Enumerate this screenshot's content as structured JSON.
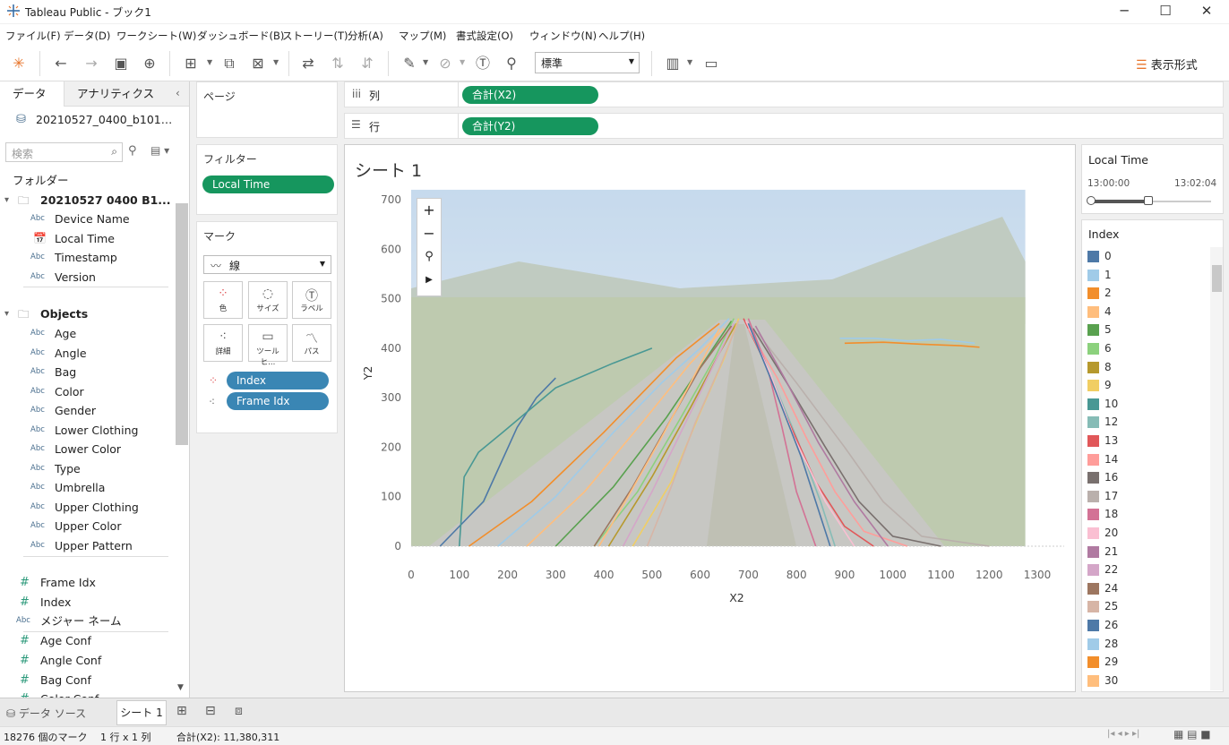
{
  "window": {
    "title": "Tableau Public - ブック1",
    "min": "─",
    "max": "☐",
    "close": "✕"
  },
  "menu": [
    "ファイル(F)",
    "データ(D)",
    "ワークシート(W)",
    "ダッシュボード(B)",
    "ストーリー(T)",
    "分析(A)",
    "マップ(M)",
    "書式設定(O)",
    "ウィンドウ(N)",
    "ヘルプ(H)"
  ],
  "toolbar": {
    "fit_select": "標準",
    "show_me": "表示形式"
  },
  "datapane": {
    "tab_data": "データ",
    "tab_analytics": "アナリティクス",
    "datasource": "20210527_0400_b101…",
    "search_placeholder": "検索",
    "folders_label": "フォルダー",
    "folder1": "20210527 0400 B1...",
    "folder1_fields": [
      {
        "type": "Abc",
        "name": "Device Name"
      },
      {
        "type": "date",
        "name": "Local Time"
      },
      {
        "type": "Abc",
        "name": "Timestamp"
      },
      {
        "type": "Abc",
        "name": "Version"
      }
    ],
    "folder2": "Objects",
    "folder2_fields": [
      "Age",
      "Angle",
      "Bag",
      "Color",
      "Gender",
      "Lower Clothing",
      "Lower Color",
      "Type",
      "Umbrella",
      "Upper Clothing",
      "Upper Color",
      "Upper Pattern"
    ],
    "type_abc": "Abc",
    "measures": [
      {
        "type": "#",
        "name": "Frame Idx"
      },
      {
        "type": "#",
        "name": "Index"
      },
      {
        "type": "Abc",
        "name": "メジャー ネーム"
      },
      {
        "type": "#",
        "name": "Age Conf"
      },
      {
        "type": "#",
        "name": "Angle Conf"
      },
      {
        "type": "#",
        "name": "Bag Conf"
      },
      {
        "type": "#",
        "name": "Color Conf"
      }
    ]
  },
  "shelves": {
    "pages": "ページ",
    "columns_label": "列",
    "columns_pill": "合計(X2)",
    "rows_label": "行",
    "rows_pill": "合計(Y2)",
    "filters": "フィルター",
    "filter_pill": "Local Time",
    "marks": "マーク",
    "mark_type": "線",
    "mark_buttons": [
      "色",
      "サイズ",
      "ラベル",
      "詳細",
      "ツールヒ...",
      "パス"
    ],
    "mark_pills": [
      "Index",
      "Frame Idx"
    ]
  },
  "sheet": {
    "title": "シート 1",
    "map_controls": [
      "+",
      "−",
      "⚲",
      "▶"
    ]
  },
  "chart_data": {
    "type": "line",
    "xlabel": "X2",
    "ylabel": "Y2",
    "xlim": [
      0,
      1300
    ],
    "ylim": [
      0,
      700
    ],
    "x_ticks": [
      0,
      100,
      200,
      300,
      400,
      500,
      600,
      700,
      800,
      900,
      1000,
      1100,
      1200,
      1300
    ],
    "y_ticks": [
      0,
      100,
      200,
      300,
      400,
      500,
      600,
      700
    ],
    "color_by": "Index",
    "background_image_extent": {
      "x": [
        0,
        1275
      ],
      "y": [
        0,
        720
      ]
    },
    "series": [
      {
        "index": 0,
        "x": [
          60,
          150,
          220,
          260,
          300
        ],
        "y": [
          0,
          90,
          240,
          300,
          340
        ]
      },
      {
        "index": 1,
        "x": [
          180,
          300,
          420,
          520,
          600,
          660
        ],
        "y": [
          0,
          100,
          230,
          330,
          400,
          460
        ]
      },
      {
        "index": 2,
        "x": [
          120,
          250,
          400,
          550,
          640
        ],
        "y": [
          0,
          90,
          230,
          380,
          450
        ]
      },
      {
        "index": 4,
        "x": [
          240,
          360,
          480,
          580,
          650
        ],
        "y": [
          0,
          110,
          250,
          370,
          440
        ]
      },
      {
        "index": 5,
        "x": [
          300,
          420,
          530,
          620,
          665
        ],
        "y": [
          0,
          120,
          260,
          390,
          455
        ]
      },
      {
        "index": 6,
        "x": [
          380,
          470,
          560,
          630,
          670
        ],
        "y": [
          0,
          110,
          260,
          380,
          460
        ]
      },
      {
        "index": 8,
        "x": [
          410,
          500,
          580,
          640,
          675
        ],
        "y": [
          0,
          140,
          280,
          390,
          450
        ]
      },
      {
        "index": 9,
        "x": [
          460,
          540,
          600,
          650,
          680
        ],
        "y": [
          0,
          130,
          270,
          380,
          460
        ]
      },
      {
        "index": 10,
        "x": [
          100,
          110,
          140,
          190,
          300,
          420,
          500
        ],
        "y": [
          0,
          140,
          190,
          230,
          320,
          370,
          400
        ]
      },
      {
        "index": 12,
        "x": [
          700,
          740,
          800,
          850,
          880
        ],
        "y": [
          450,
          360,
          220,
          90,
          0
        ]
      },
      {
        "index": 13,
        "x": [
          690,
          730,
          780,
          840,
          900,
          960
        ],
        "y": [
          460,
          380,
          260,
          130,
          40,
          0
        ]
      },
      {
        "index": 14,
        "x": [
          700,
          760,
          820,
          880,
          940,
          1030
        ],
        "y": [
          440,
          340,
          220,
          110,
          30,
          0
        ]
      },
      {
        "index": 16,
        "x": [
          710,
          780,
          860,
          930,
          1000,
          1100
        ],
        "y": [
          440,
          330,
          200,
          90,
          20,
          0
        ]
      },
      {
        "index": 17,
        "x": [
          720,
          800,
          900,
          980,
          1060,
          1200
        ],
        "y": [
          430,
          330,
          200,
          90,
          20,
          0
        ]
      },
      {
        "index": 18,
        "x": [
          700,
          740,
          770,
          800,
          840
        ],
        "y": [
          460,
          360,
          240,
          110,
          0
        ]
      },
      {
        "index": 20,
        "x": [
          695,
          745,
          795,
          860,
          920
        ],
        "y": [
          455,
          350,
          220,
          90,
          0
        ]
      },
      {
        "index": 21,
        "x": [
          715,
          775,
          845,
          920,
          990
        ],
        "y": [
          445,
          340,
          210,
          90,
          0
        ]
      },
      {
        "index": 22,
        "x": [
          670,
          620,
          560,
          500,
          440
        ],
        "y": [
          450,
          350,
          230,
          110,
          0
        ]
      },
      {
        "index": 24,
        "x": [
          665,
          600,
          530,
          460,
          380
        ],
        "y": [
          445,
          360,
          240,
          120,
          0
        ]
      },
      {
        "index": 25,
        "x": [
          680,
          640,
          590,
          540,
          490
        ],
        "y": [
          455,
          360,
          250,
          120,
          0
        ]
      },
      {
        "index": 26,
        "x": [
          700,
          750,
          810,
          870
        ],
        "y": [
          450,
          330,
          180,
          0
        ]
      },
      {
        "index": 28,
        "x": [
          890,
          960,
          1030,
          1100,
          1170
        ],
        "y": [
          420,
          420,
          415,
          418,
          410
        ]
      },
      {
        "index": 29,
        "x": [
          900,
          980,
          1060,
          1140,
          1180
        ],
        "y": [
          410,
          412,
          408,
          405,
          402
        ]
      },
      {
        "index": 30,
        "x": [
          640,
          580,
          520,
          450,
          390
        ],
        "y": [
          440,
          330,
          220,
          100,
          0
        ]
      }
    ]
  },
  "legend_filter": {
    "title": "Local Time",
    "start": "13:00:00",
    "end": "13:02:04",
    "range_fraction": [
      0.0,
      0.48
    ]
  },
  "legend_color": {
    "title": "Index",
    "items": [
      {
        "label": "0",
        "color": "#4e79a7"
      },
      {
        "label": "1",
        "color": "#a0cbe8"
      },
      {
        "label": "2",
        "color": "#f28e2b"
      },
      {
        "label": "4",
        "color": "#ffbe7d"
      },
      {
        "label": "5",
        "color": "#59a14f"
      },
      {
        "label": "6",
        "color": "#8cd17d"
      },
      {
        "label": "8",
        "color": "#b6992d"
      },
      {
        "label": "9",
        "color": "#f1ce63"
      },
      {
        "label": "10",
        "color": "#499894"
      },
      {
        "label": "12",
        "color": "#86bcb6"
      },
      {
        "label": "13",
        "color": "#e15759"
      },
      {
        "label": "14",
        "color": "#ff9d9a"
      },
      {
        "label": "16",
        "color": "#79706e"
      },
      {
        "label": "17",
        "color": "#bab0ac"
      },
      {
        "label": "18",
        "color": "#d37295"
      },
      {
        "label": "20",
        "color": "#fabfd2"
      },
      {
        "label": "21",
        "color": "#b07aa1"
      },
      {
        "label": "22",
        "color": "#d4a6c8"
      },
      {
        "label": "24",
        "color": "#9d7660"
      },
      {
        "label": "25",
        "color": "#d7b5a6"
      },
      {
        "label": "26",
        "color": "#4e79a7"
      },
      {
        "label": "28",
        "color": "#a0cbe8"
      },
      {
        "label": "29",
        "color": "#f28e2b"
      },
      {
        "label": "30",
        "color": "#ffbe7d"
      }
    ]
  },
  "tabs": {
    "datasource": "データ ソース",
    "sheet1": "シート 1"
  },
  "status": {
    "marks": "18276 個のマーク",
    "dims": "1 行 x 1 列",
    "sum": "合計(X2): 11,380,311"
  }
}
